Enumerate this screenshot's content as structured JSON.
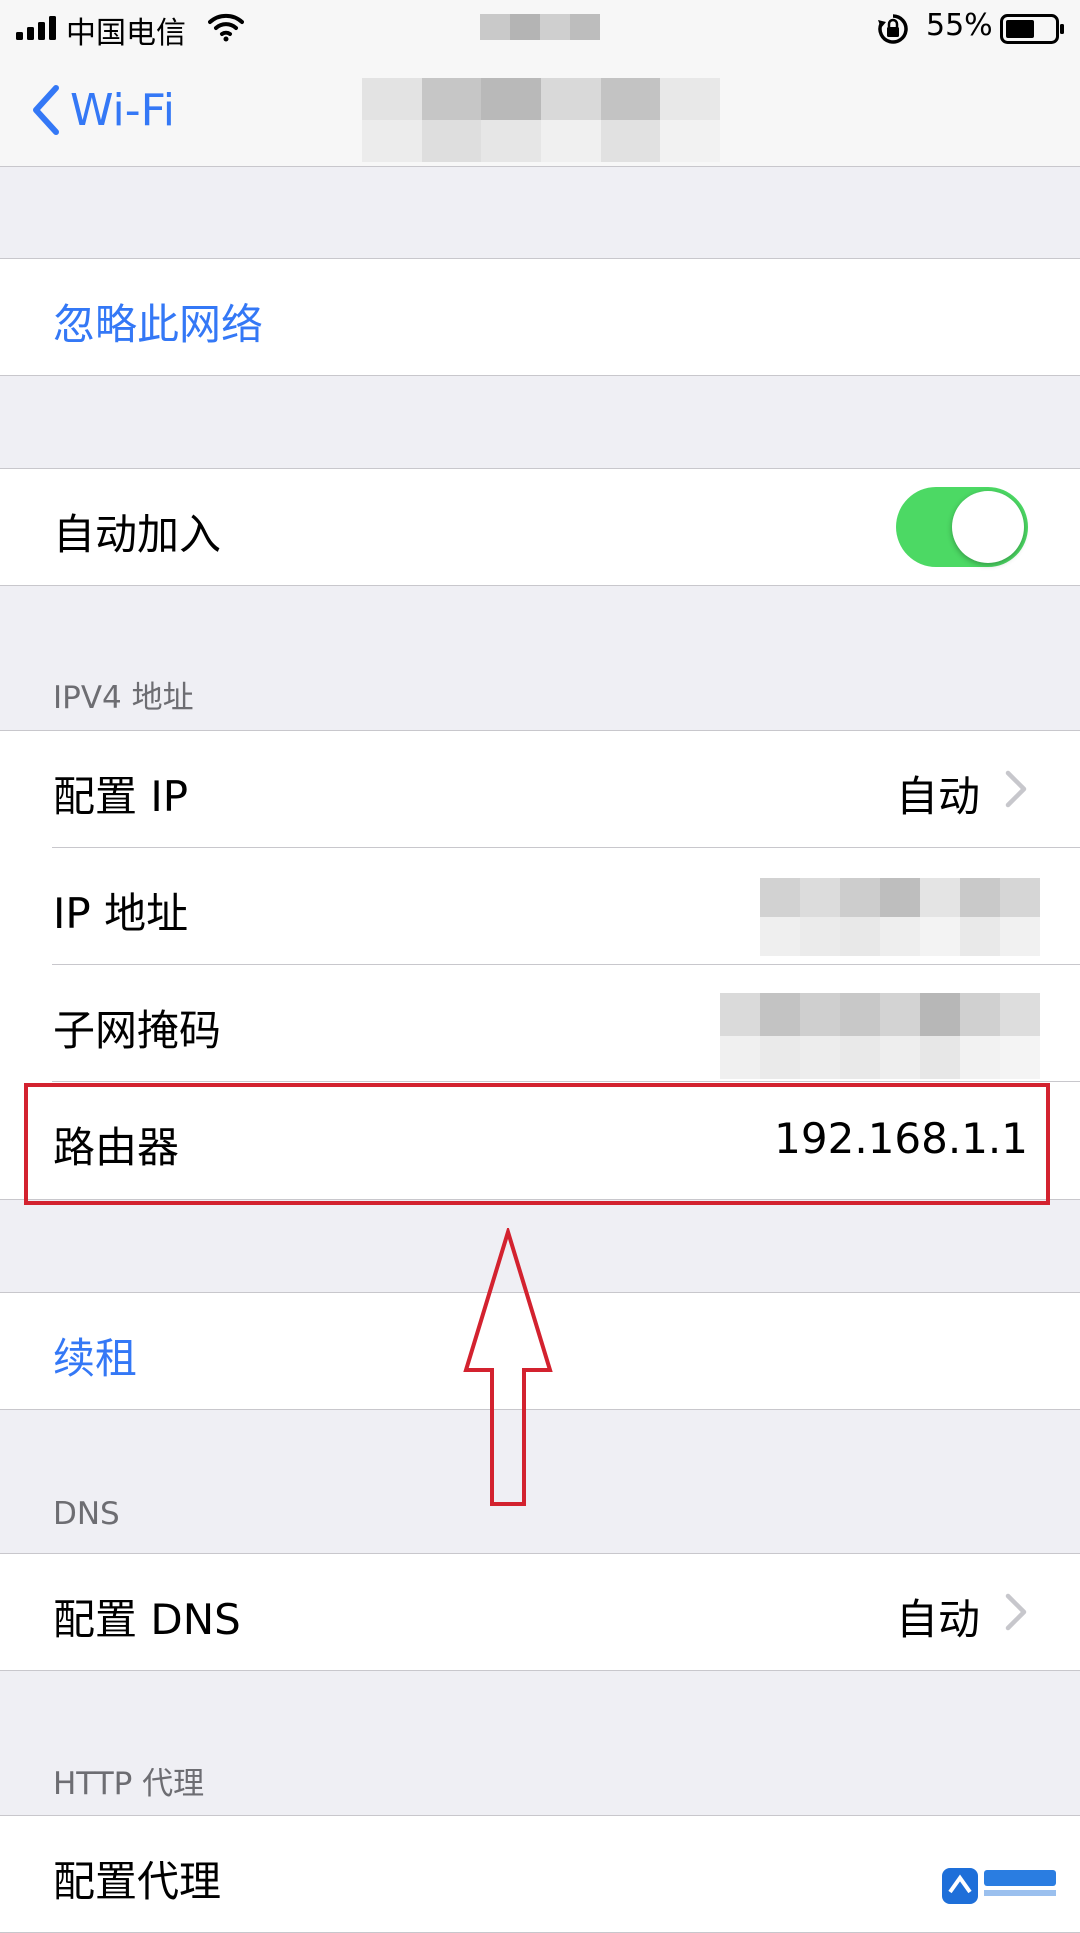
{
  "status_bar": {
    "carrier": "中国电信",
    "battery": "55%"
  },
  "nav": {
    "back_label": "Wi-Fi"
  },
  "forget_network": "忽略此网络",
  "auto_join": {
    "label": "自动加入",
    "enabled": true
  },
  "ipv4_section": {
    "header": "IPV4 地址",
    "rows": [
      {
        "label": "配置 IP",
        "value": "自动"
      },
      {
        "label": "IP 地址",
        "value": ""
      },
      {
        "label": "子网掩码",
        "value": ""
      },
      {
        "label": "路由器",
        "value": "192.168.1.1"
      }
    ]
  },
  "renew_lease": "续租",
  "dns_section": {
    "header": "DNS",
    "row": {
      "label": "配置 DNS",
      "value": "自动"
    }
  },
  "http_proxy_section": {
    "header": "HTTP 代理",
    "row": {
      "label": "配置代理"
    }
  },
  "colors": {
    "accent": "#3478f6",
    "toggle_on": "#4cd964",
    "highlight": "#d3222f",
    "background": "#efeff4"
  }
}
